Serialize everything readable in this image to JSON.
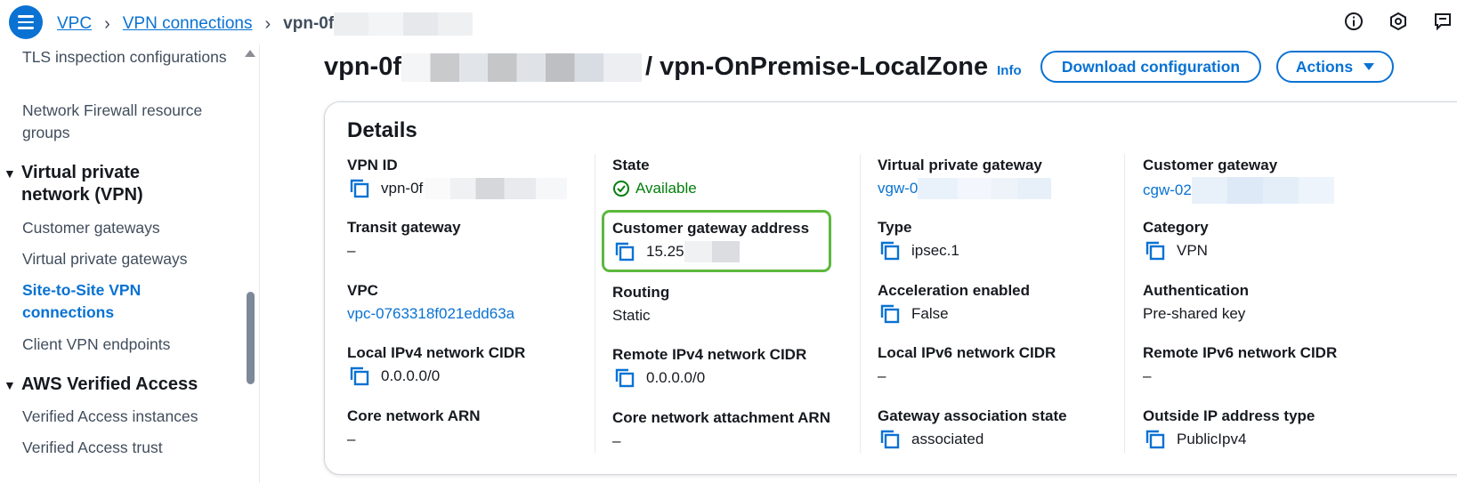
{
  "breadcrumb": {
    "items": [
      "VPC",
      "VPN connections"
    ],
    "current": "vpn-0f"
  },
  "sidebar": {
    "items": [
      {
        "label": "TLS inspection configurations",
        "type": "item"
      },
      {
        "label": "Network Firewall resource groups",
        "type": "item"
      },
      {
        "label": "Virtual private network (VPN)",
        "type": "section"
      },
      {
        "label": "Customer gateways",
        "type": "item"
      },
      {
        "label": "Virtual private gateways",
        "type": "item"
      },
      {
        "label": "Site-to-Site VPN connections",
        "type": "item",
        "active": true
      },
      {
        "label": "Client VPN endpoints",
        "type": "item"
      },
      {
        "label": "AWS Verified Access",
        "type": "section"
      },
      {
        "label": "Verified Access instances",
        "type": "item"
      },
      {
        "label": "Verified Access trust",
        "type": "item"
      }
    ]
  },
  "header": {
    "title_prefix": "vpn-0f",
    "title_suffix": "/ vpn-OnPremise-LocalZone",
    "info": "Info",
    "download_label": "Download configuration",
    "actions_label": "Actions"
  },
  "details": {
    "title": "Details",
    "columns": [
      [
        {
          "label": "VPN ID",
          "value": "vpn-0f",
          "copy": true
        },
        {
          "label": "Transit gateway",
          "value": "–"
        },
        {
          "label": "VPC",
          "value": "vpc-0763318f021edd63a",
          "link": true
        },
        {
          "label": "Local IPv4 network CIDR",
          "value": "0.0.0.0/0",
          "copy": true
        },
        {
          "label": "Core network ARN",
          "value": "–"
        }
      ],
      [
        {
          "label": "State",
          "value": "Available",
          "status": "ok"
        },
        {
          "label": "Customer gateway address",
          "value": "15.25",
          "copy": true,
          "highlight": true
        },
        {
          "label": "Routing",
          "value": "Static"
        },
        {
          "label": "Remote IPv4 network CIDR",
          "value": "0.0.0.0/0",
          "copy": true
        },
        {
          "label": "Core network attachment ARN",
          "value": "–"
        }
      ],
      [
        {
          "label": "Virtual private gateway",
          "value": "vgw-0",
          "link": true
        },
        {
          "label": "Type",
          "value": "ipsec.1",
          "copy": true
        },
        {
          "label": "Acceleration enabled",
          "value": "False",
          "copy": true
        },
        {
          "label": "Local IPv6 network CIDR",
          "value": "–"
        },
        {
          "label": "Gateway association state",
          "value": "associated",
          "copy": true
        }
      ],
      [
        {
          "label": "Customer gateway",
          "value": "cgw-02",
          "link": true
        },
        {
          "label": "Category",
          "value": "VPN",
          "copy": true
        },
        {
          "label": "Authentication",
          "value": "Pre-shared key"
        },
        {
          "label": "Remote IPv6 network CIDR",
          "value": "–"
        },
        {
          "label": "Outside IP address type",
          "value": "PublicIpv4",
          "copy": true
        }
      ]
    ]
  },
  "icons": {
    "menu": "hamburger-menu-icon",
    "info": "info-circle-icon",
    "settings": "hexagon-settings-icon",
    "feedback": "feedback-icon",
    "copy": "copy-icon",
    "status": "check-circle-icon"
  },
  "colors": {
    "accent": "#0972d3",
    "success": "#037f0c",
    "highlight": "#5cb83e"
  }
}
